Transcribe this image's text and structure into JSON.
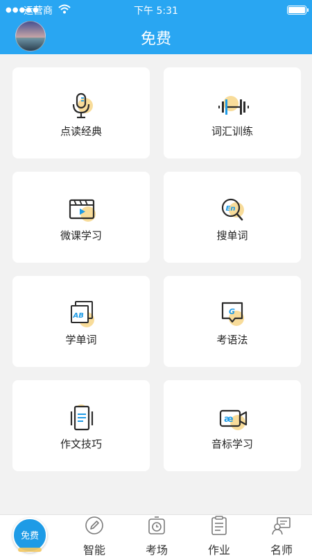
{
  "status": {
    "carrier": "运营商",
    "time": "下午 5:31"
  },
  "header": {
    "title": "免费"
  },
  "cards": [
    {
      "label": "点读经典",
      "icon": "microphone-icon"
    },
    {
      "label": "词汇训练",
      "icon": "dumbbell-icon"
    },
    {
      "label": "微课学习",
      "icon": "video-player-icon"
    },
    {
      "label": "搜单词",
      "icon": "search-en-icon"
    },
    {
      "label": "学单词",
      "icon": "ab-card-icon"
    },
    {
      "label": "考语法",
      "icon": "g-chat-icon"
    },
    {
      "label": "作文技巧",
      "icon": "phone-document-icon"
    },
    {
      "label": "音标学习",
      "icon": "ae-camera-icon"
    }
  ],
  "tabbar": {
    "active": "免费",
    "tabs": [
      {
        "label": "智能",
        "icon": "pencil-icon"
      },
      {
        "label": "考场",
        "icon": "clock-icon"
      },
      {
        "label": "作业",
        "icon": "clipboard-icon"
      },
      {
        "label": "名师",
        "icon": "teacher-icon"
      }
    ]
  },
  "colors": {
    "header": "#29a6f2",
    "accent_yellow": "#f8dc9a",
    "icon_dark": "#2b2b2b",
    "icon_blue": "#1e9be6"
  }
}
